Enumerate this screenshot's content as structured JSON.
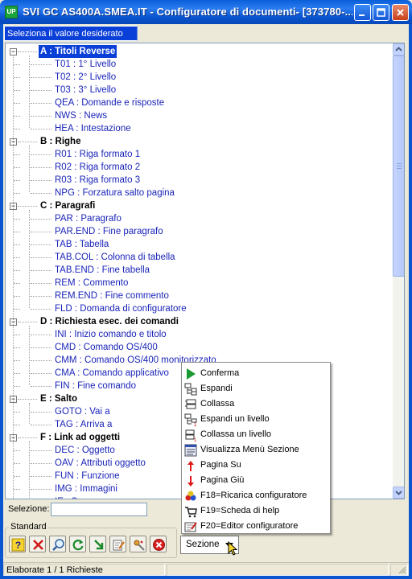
{
  "window": {
    "title": "SVI GC AS400A.SMEA.IT - Configuratore di documenti- [373780-...",
    "app_badge": "UP"
  },
  "header_tab": "Seleziona il valore desiderato",
  "tree": [
    {
      "label": "A : Titoli Reverse",
      "selected": true,
      "items": [
        "T01 : 1° Livello",
        "T02 : 2° Livello",
        "T03 : 3° Livello",
        "QEA : Domande e risposte",
        "NWS : News",
        "HEA : Intestazione"
      ]
    },
    {
      "label": "B : Righe",
      "items": [
        "R01 : Riga formato 1",
        "R02 : Riga formato 2",
        "R03 : Riga formato 3",
        "NPG : Forzatura salto pagina"
      ]
    },
    {
      "label": "C : Paragrafi",
      "items": [
        "PAR : Paragrafo",
        "PAR.END : Fine paragrafo",
        "TAB : Tabella",
        "TAB.COL : Colonna di tabella",
        "TAB.END : Fine tabella",
        "REM : Commento",
        "REM.END : Fine commento",
        "FLD : Domanda di configuratore"
      ]
    },
    {
      "label": "D : Richiesta esec. dei comandi",
      "items": [
        "INI : Inizio comando e titolo",
        "CMD : Comando OS/400",
        "CMM : Comando OS/400 monitorizzato",
        "CMA : Comando applicativo",
        "FIN : Fine comando"
      ]
    },
    {
      "label": "E : Salto",
      "items": [
        "GOTO : Vai a",
        "TAG : Arriva a"
      ]
    },
    {
      "label": "F : Link ad oggetti",
      "items": [
        "DEC : Oggetto",
        "OAV : Attributi oggetto",
        "FUN : Funzione",
        "IMG : Immagini",
        "IE : S..."
      ]
    }
  ],
  "selection": {
    "label": "Selezione:",
    "value": ""
  },
  "toolbar": {
    "group_label": "Standard",
    "buttons": [
      "help-icon",
      "cancel-icon",
      "search-icon",
      "refresh-icon",
      "download-icon",
      "edit-icon",
      "settings-icon",
      "stop-icon"
    ]
  },
  "sezione": {
    "label": "Sezione"
  },
  "context_menu": [
    {
      "label": "Conferma",
      "icon": "play-icon"
    },
    {
      "label": "Espandi",
      "icon": "expand-icon"
    },
    {
      "label": "Collassa",
      "icon": "collapse-icon"
    },
    {
      "label": "Espandi un livello",
      "icon": "expand-level-icon"
    },
    {
      "label": "Collassa un livello",
      "icon": "collapse-level-icon"
    },
    {
      "label": "Visualizza Menù Sezione",
      "icon": "menu-icon"
    },
    {
      "label": "Pagina Su",
      "icon": "arrow-up-icon"
    },
    {
      "label": "Pagina Giù",
      "icon": "arrow-down-icon"
    },
    {
      "label": "F18=Ricarica configuratore",
      "icon": "reload-icon"
    },
    {
      "label": "F19=Scheda di help",
      "icon": "help-cart-icon"
    },
    {
      "label": "F20=Editor configuratore",
      "icon": "editor-icon"
    }
  ],
  "status": {
    "text": "Elaborate 1 / 1 Richieste"
  },
  "colors": {
    "accent": "#0a3fd8",
    "item_text": "#1a24b8",
    "titlebar": "#0a55d0"
  }
}
